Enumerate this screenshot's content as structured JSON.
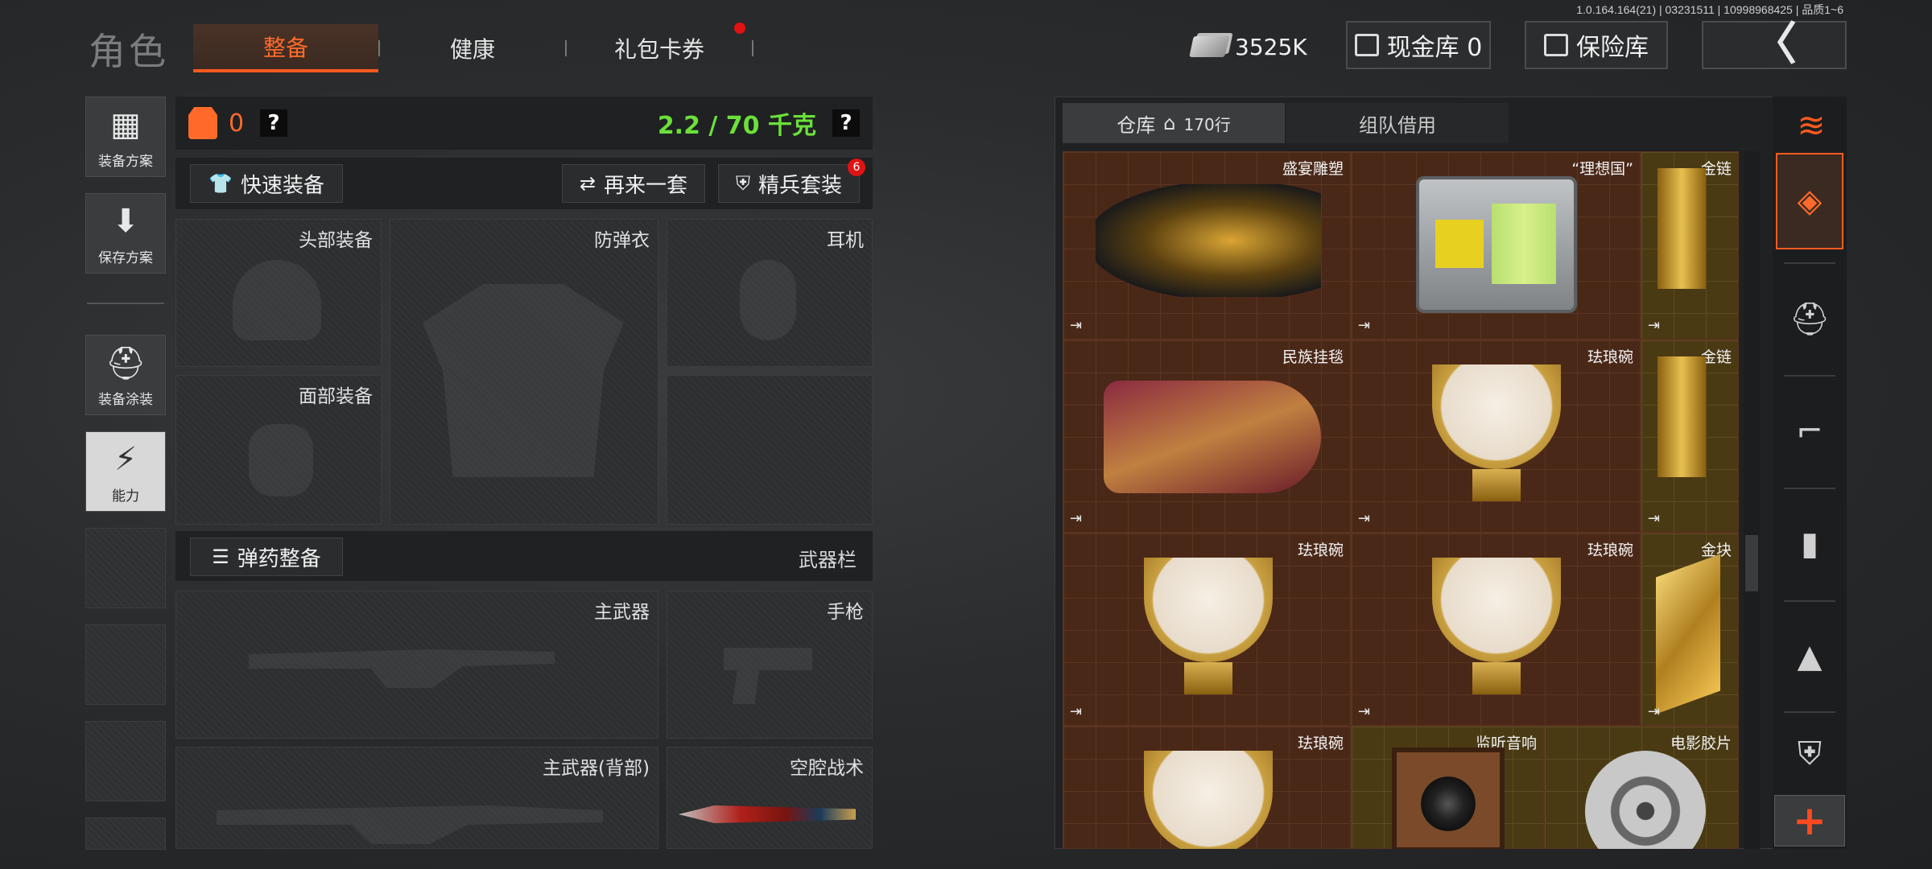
{
  "version": "1.0.164.164(21) | 03231511 | 10998968425 | 品质1~6",
  "page_title": "角色",
  "tabs": [
    {
      "label": "整备"
    },
    {
      "label": "健康"
    },
    {
      "label": "礼包卡券"
    }
  ],
  "currency": {
    "amount": "3525K"
  },
  "cash_vault": {
    "label": "现金库 0"
  },
  "safe": {
    "label": "保险库"
  },
  "back_glyph": "〈",
  "sidebar": [
    {
      "label": "装备方案"
    },
    {
      "label": "保存方案"
    },
    {
      "label": "装备涂装"
    },
    {
      "label": "能力"
    }
  ],
  "equip": {
    "armor_count": "0",
    "help": "?",
    "weight": "2.2 / 70 千克",
    "quick_equip": "快速装备",
    "again": "再来一套",
    "elite": "精兵套装",
    "elite_badge": "6",
    "slots": {
      "head": "头部装备",
      "vest": "防弹衣",
      "headset": "耳机",
      "face": "面部装备",
      "main": "主武器",
      "pistol": "手枪",
      "main_back": "主武器(背部)",
      "melee": "空腔战术"
    },
    "ammo": "弹药整备",
    "weapon_bar": "武器栏"
  },
  "warehouse": {
    "tab_storage": "仓库",
    "rows": "170行",
    "tab_team": "组队借用",
    "items": [
      {
        "name": "盛宴雕塑"
      },
      {
        "name": "“理想国”"
      },
      {
        "name": "金链"
      },
      {
        "name": "民族挂毯"
      },
      {
        "name": "珐琅碗"
      },
      {
        "name": "金链"
      },
      {
        "name": "珐琅碗"
      },
      {
        "name": "珐琅碗"
      },
      {
        "name": "金块"
      },
      {
        "name": "珐琅碗"
      },
      {
        "name": "监听音响"
      },
      {
        "name": "电影胶片"
      }
    ],
    "exit_glyph": "⇥"
  },
  "categories": [
    {
      "icon": "stack-icon"
    },
    {
      "icon": "helmet-icon"
    },
    {
      "icon": "rifle-icon"
    },
    {
      "icon": "magazine-icon"
    },
    {
      "icon": "bullet-icon"
    },
    {
      "icon": "armor-icon"
    }
  ],
  "plus": "+"
}
